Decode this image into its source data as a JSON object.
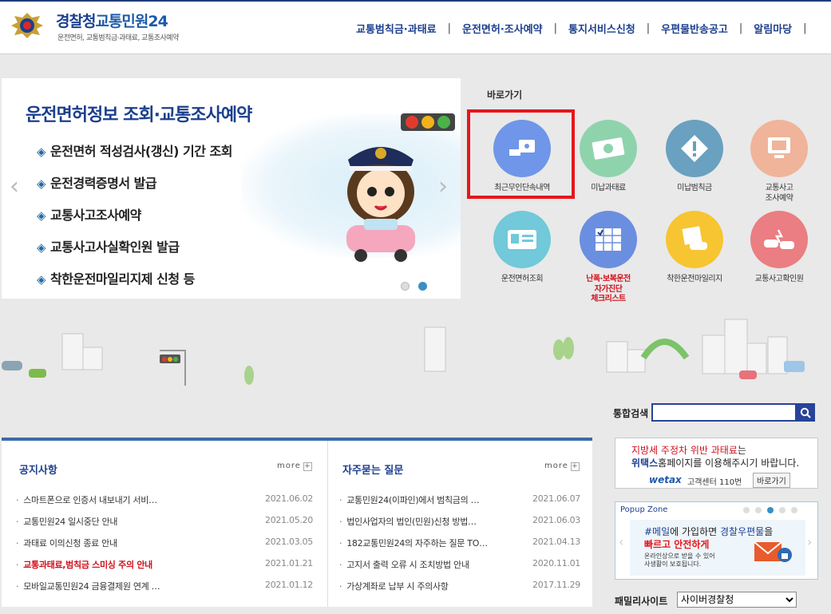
{
  "header": {
    "logo_main": "경찰청",
    "logo_service": "교통민원24",
    "logo_sub": "운전면허, 교통범칙금·과태료, 교통조사예약",
    "nav": [
      "교통범칙금·과태료",
      "운전면허·조사예약",
      "통지서비스신청",
      "우편물반송공고",
      "알림마당"
    ],
    "nav_sep": "|"
  },
  "banner": {
    "title": "운전면허정보 조회·교통조사예약",
    "items": [
      "운전면허 적성검사(갱신) 기간 조회",
      "운전경력증명서 발급",
      "교통사고조사예약",
      "교통사고사실확인원 발급",
      "착한운전마일리지제 신청 등"
    ],
    "bullet": "◈",
    "prev": "‹",
    "next": "›"
  },
  "shortcuts": {
    "title": "바로가기",
    "items": [
      {
        "label": "최근무인단속내역",
        "icon": "camera-icon",
        "color": "#6f96e8"
      },
      {
        "label": "미납과태료",
        "icon": "money-icon",
        "color": "#8fd3ad"
      },
      {
        "label": "미납범칙금",
        "icon": "warning-icon",
        "color": "#6aa0c0"
      },
      {
        "label": "교통사고\n조사예약",
        "icon": "computer-icon",
        "color": "#f0b49a"
      },
      {
        "label": "운전면허조회",
        "icon": "license-icon",
        "color": "#71c9d9"
      },
      {
        "label": "난폭·보복운전\n자가진단\n체크리스트",
        "icon": "checklist-icon",
        "color": "#6a8fe0"
      },
      {
        "label": "착한운전마일리지",
        "icon": "mileage-icon",
        "color": "#f6c531"
      },
      {
        "label": "교통사고확인원",
        "icon": "accident-icon",
        "color": "#ea7e82"
      }
    ]
  },
  "search": {
    "label": "통합검색",
    "value": ""
  },
  "notice": {
    "title": "공지사항",
    "more": "more",
    "rows": [
      {
        "text": "스마트폰으로 인증서 내보내기 서비…",
        "date": "2021.06.02",
        "hot": false
      },
      {
        "text": "교통민원24 일시중단 안내",
        "date": "2021.05.20",
        "hot": false
      },
      {
        "text": "과태료 이의신청 종료 안내",
        "date": "2021.03.05",
        "hot": false
      },
      {
        "text": "교통과태료,범칙금 스미싱 주의 안내",
        "date": "2021.01.21",
        "hot": true
      },
      {
        "text": "모바일교통민원24 금융결제원 연계 …",
        "date": "2021.01.12",
        "hot": false
      }
    ]
  },
  "faq": {
    "title": "자주묻는 질문",
    "more": "more",
    "rows": [
      {
        "text": "교통민원24(이파인)에서 범칙금의 …",
        "date": "2021.06.07"
      },
      {
        "text": "법인사업자의 법인(민원)신청 방법…",
        "date": "2021.06.03"
      },
      {
        "text": "182교통민원24의 자주하는 질문 TO…",
        "date": "2021.04.13"
      },
      {
        "text": "고지서 출력 오류 시 조치방법 안내",
        "date": "2020.11.01"
      },
      {
        "text": "가상계좌로 납부 시 주의사항",
        "date": "2017.11.29"
      }
    ]
  },
  "tax_banner": {
    "line1_red": "지방세 주정차 위반 과태료",
    "line1_rest": "는",
    "line2_red": "위택스",
    "line2_rest": "홈페이지를 이용해주시기 바랍니다.",
    "brand": "wetax",
    "center": "고객센터 110번",
    "button": "바로가기"
  },
  "popup": {
    "title": "Popup Zone",
    "line1a": "#메일",
    "line1b": "에 가입하면 ",
    "line1c": "경찰우편물",
    "line1d": "을",
    "line2": "빠르고 안전하게",
    "line3": "온라인상으로 받을 수 있어",
    "line4": "사생활이 보호됩니다."
  },
  "family": {
    "label": "패밀리사이트",
    "selected": "사이버경찰청"
  },
  "colors": {
    "brand_blue": "#1d3f8f",
    "highlight_red": "#e5171c",
    "hot_red": "#d0101b"
  }
}
